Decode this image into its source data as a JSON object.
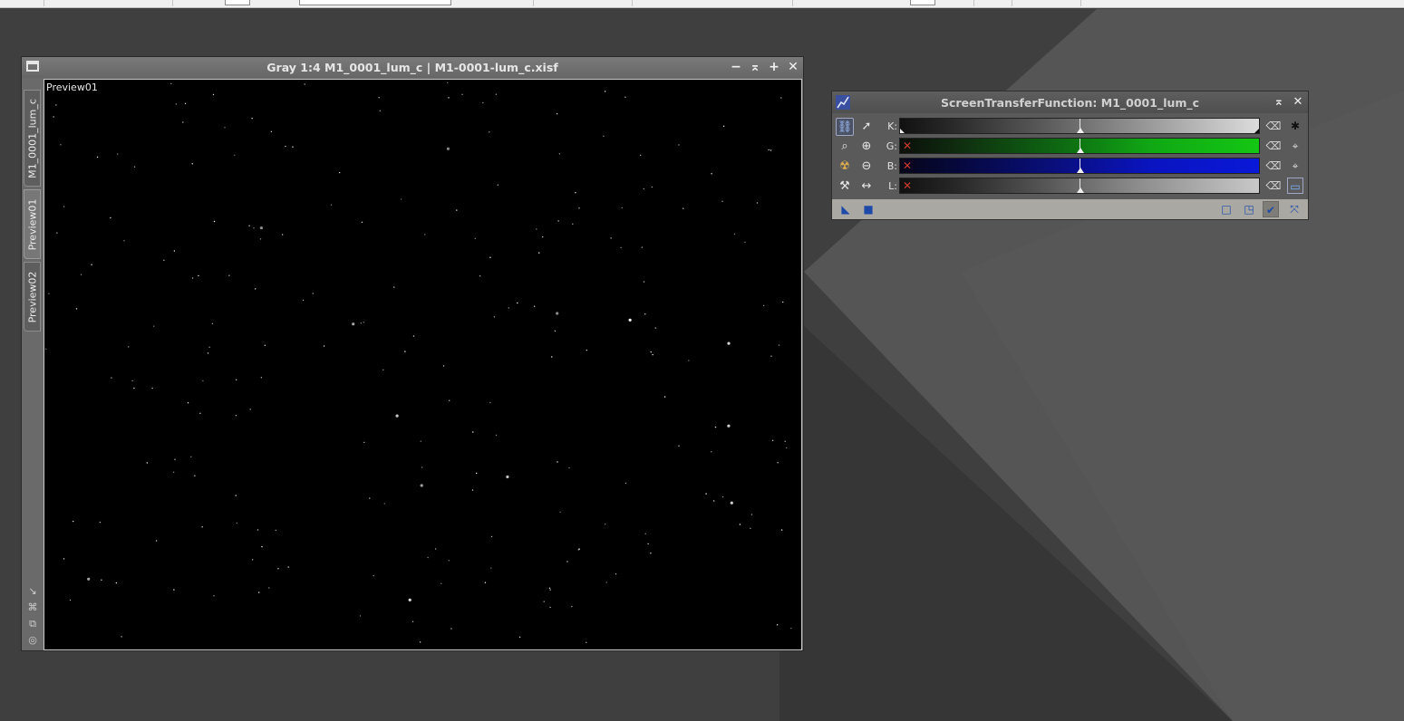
{
  "image_window": {
    "title": "Gray 1:4 M1_0001_lum_c | M1-0001-lum_c.xisf",
    "tabs": [
      "M1_0001_lum_c",
      "Preview01",
      "Preview02"
    ],
    "active_preview_label": "Preview01",
    "controls": {
      "minimize": "−",
      "shade": "⌅",
      "maximize": "+",
      "close": "✕"
    }
  },
  "stf": {
    "title": "ScreenTransferFunction: M1_0001_lum_c",
    "channels": [
      {
        "label": "K:",
        "color_from": "#111111",
        "color_to": "#e0e0e0",
        "linked": false
      },
      {
        "label": "G:",
        "color_from": "#0a0f0a",
        "color_to": "#14c614",
        "linked": true
      },
      {
        "label": "B:",
        "color_from": "#06061a",
        "color_to": "#0a18d8",
        "linked": true
      },
      {
        "label": "L:",
        "color_from": "#111111",
        "color_to": "#c8c8c8",
        "linked": true
      }
    ],
    "left_tools": [
      "link-icon",
      "pointer-icon",
      "zoom-in-icon",
      "zoom-in-plus-icon",
      "nuclear-icon",
      "zoom-out-icon",
      "wrench-icon",
      "fit-width-icon"
    ],
    "right_tools": [
      "reset-icon",
      "settings-icon",
      "track-view-icon",
      "monitor-icon"
    ]
  }
}
